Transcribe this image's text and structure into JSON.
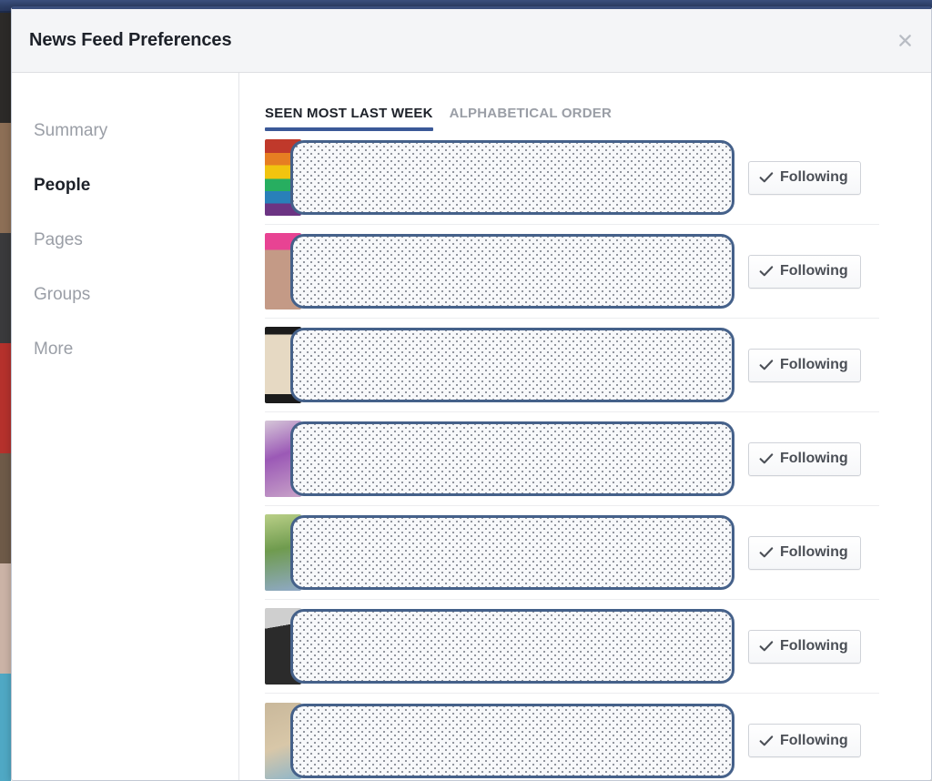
{
  "window": {
    "topbar_color": "#3b4f7d"
  },
  "modal": {
    "title": "News Feed Preferences",
    "close_label": "×",
    "accent_color": "#3b5998",
    "header_bg": "#f4f5f7"
  },
  "sidebar": {
    "items": [
      {
        "label": "Summary",
        "active": false
      },
      {
        "label": "People",
        "active": true
      },
      {
        "label": "Pages",
        "active": false
      },
      {
        "label": "Groups",
        "active": false
      },
      {
        "label": "More",
        "active": false
      }
    ]
  },
  "content": {
    "tabs": [
      {
        "label": "SEEN MOST LAST WEEK",
        "active": true
      },
      {
        "label": "ALPHABETICAL ORDER",
        "active": false
      }
    ],
    "people": [
      {
        "name": "",
        "redacted": true,
        "follow_label": "Following",
        "avatar_kind": "rainbow-flag"
      },
      {
        "name": "",
        "redacted": true,
        "follow_label": "Following",
        "avatar_kind": "portrait-pink-banner"
      },
      {
        "name": "",
        "redacted": true,
        "follow_label": "Following",
        "avatar_kind": "journal-cover"
      },
      {
        "name": "",
        "redacted": true,
        "follow_label": "Following",
        "avatar_kind": "purple-flowers"
      },
      {
        "name": "",
        "redacted": true,
        "follow_label": "Following",
        "avatar_kind": "outdoor-green"
      },
      {
        "name": "",
        "redacted": true,
        "follow_label": "Following",
        "avatar_kind": "person-cap-dark"
      },
      {
        "name": "",
        "redacted": true,
        "follow_label": "Following",
        "avatar_kind": "beach-tan"
      }
    ]
  },
  "background_strip": {
    "left_tiles": [
      "#2c2a28",
      "#8d6f56",
      "#3a3a3c",
      "#b5312c",
      "#6e5a48",
      "#cbb3a6",
      "#4fa8c4"
    ],
    "right_tiles": [
      "#f2f2f2",
      "#e8e8e8",
      "#f2f2f2",
      "#e8e8e8"
    ]
  }
}
